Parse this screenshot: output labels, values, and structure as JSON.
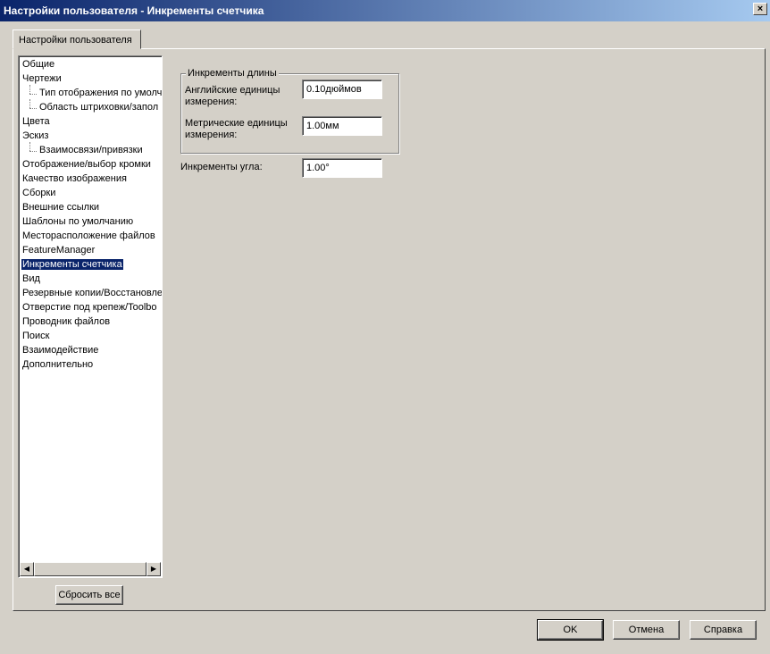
{
  "window": {
    "title": "Настройки пользователя - Инкременты счетчика",
    "close_glyph": "×"
  },
  "tab": {
    "label": "Настройки пользователя"
  },
  "tree": {
    "items": [
      {
        "label": "Общие",
        "level": 0
      },
      {
        "label": "Чертежи",
        "level": 0
      },
      {
        "label": "Тип отображения по умолч",
        "level": 1
      },
      {
        "label": "Область штриховки/запол",
        "level": 1
      },
      {
        "label": "Цвета",
        "level": 0
      },
      {
        "label": "Эскиз",
        "level": 0
      },
      {
        "label": "Взаимосвязи/привязки",
        "level": 1
      },
      {
        "label": "Отображение/выбор кромки",
        "level": 0
      },
      {
        "label": "Качество изображения",
        "level": 0
      },
      {
        "label": "Сборки",
        "level": 0
      },
      {
        "label": "Внешние ссылки",
        "level": 0
      },
      {
        "label": "Шаблоны по умолчанию",
        "level": 0
      },
      {
        "label": "Месторасположение файлов",
        "level": 0
      },
      {
        "label": "FeatureManager",
        "level": 0
      },
      {
        "label": "Инкременты счетчика",
        "level": 0,
        "selected": true
      },
      {
        "label": "Вид",
        "level": 0
      },
      {
        "label": "Резервные копии/Восстановле",
        "level": 0
      },
      {
        "label": "Отверстие под крепеж/Toolbo",
        "level": 0
      },
      {
        "label": "Проводник файлов",
        "level": 0
      },
      {
        "label": "Поиск",
        "level": 0
      },
      {
        "label": "Взаимодействие",
        "level": 0
      },
      {
        "label": "Дополнительно",
        "level": 0
      }
    ],
    "scroll_left_glyph": "◀",
    "scroll_right_glyph": "▶"
  },
  "reset_button": {
    "label": "Сбросить все"
  },
  "length_group": {
    "title": "Инкременты длины",
    "english_label_1": "Английские единицы",
    "english_label_2": "измерения:",
    "english_value": "0.10дюймов",
    "metric_label_1": "Метрические единицы",
    "metric_label_2": "измерения:",
    "metric_value": "1.00мм"
  },
  "angle": {
    "label": "Инкременты угла:",
    "value": "1.00°"
  },
  "footer": {
    "ok_label": "OK",
    "cancel_label": "Отмена",
    "help_label": "Справка"
  }
}
